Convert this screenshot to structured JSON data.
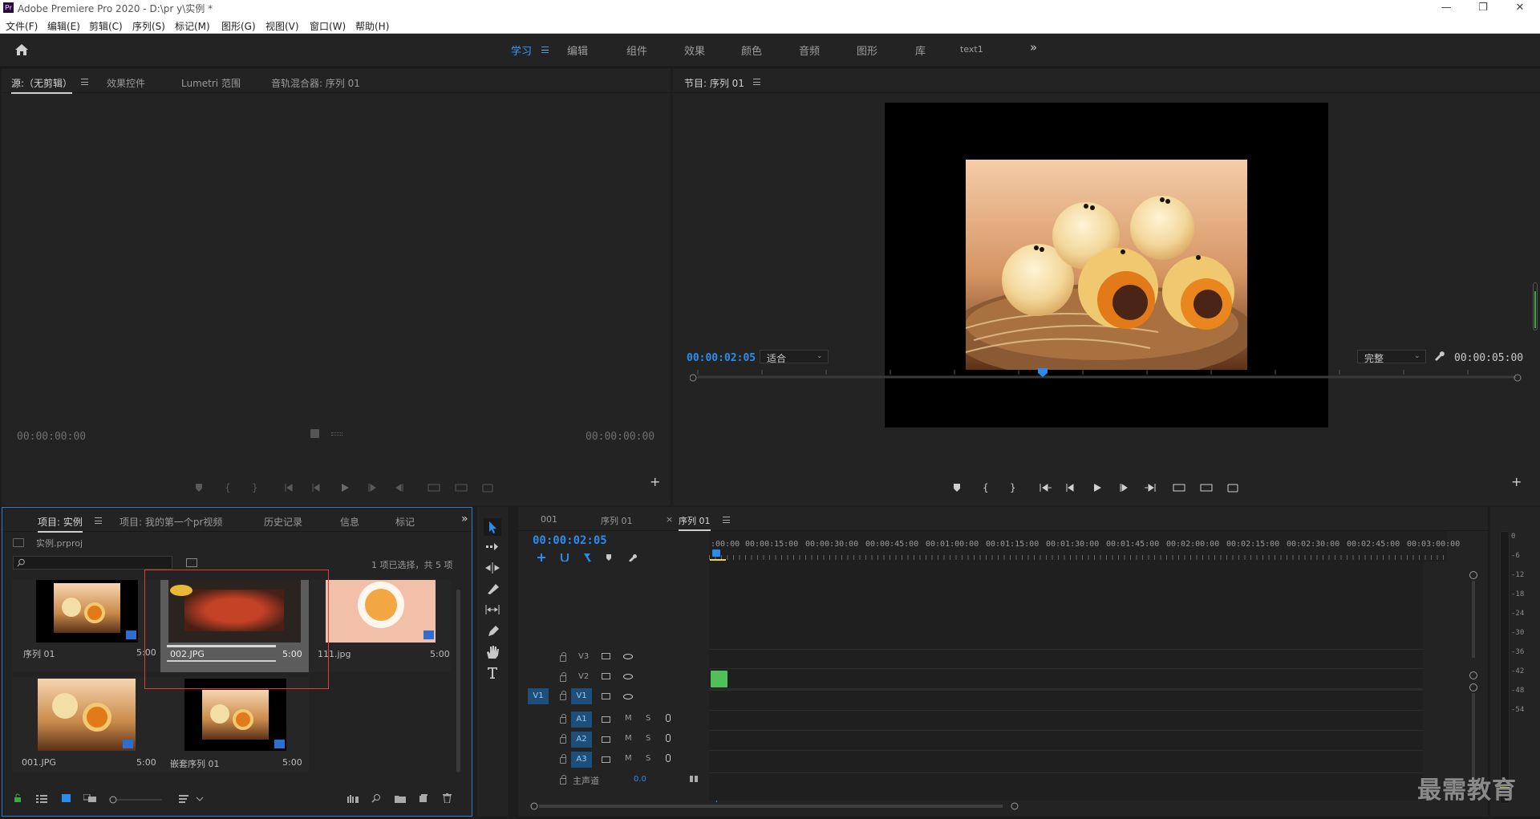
{
  "window": {
    "logo_text": "Pr",
    "title": "Adobe Premiere Pro 2020 - D:\\pr y\\实例 *",
    "minimize": "—",
    "maximize": "❐",
    "close": "✕"
  },
  "menu": [
    "文件(F)",
    "编辑(E)",
    "剪辑(C)",
    "序列(S)",
    "标记(M)",
    "图形(G)",
    "视图(V)",
    "窗口(W)",
    "帮助(H)"
  ],
  "workspaces": {
    "items": [
      "学习",
      "编辑",
      "组件",
      "效果",
      "颜色",
      "音频",
      "图形",
      "库",
      "text1"
    ],
    "active": "学习",
    "more": "»"
  },
  "source_panel": {
    "tabs": [
      "源:（无剪辑）",
      "效果控件",
      "Lumetri 范围",
      "音轨混合器: 序列 01"
    ],
    "timecode_left": "00:00:00:00",
    "timecode_right": "00:00:00:00",
    "add": "+"
  },
  "program_panel": {
    "title": "节目: 序列 01",
    "timecode": "00:00:02:05",
    "zoom": "适合",
    "quality": "完整",
    "duration": "00:00:05:00",
    "add": "+"
  },
  "project_panel": {
    "tabs": [
      "项目: 实例",
      "项目: 我的第一个pr视频",
      "历史记录",
      "信息",
      "标记"
    ],
    "more": "»",
    "file": "实例.prproj",
    "search_placeholder": "",
    "selection_info": "1 项已选择，共 5 项",
    "items": [
      {
        "name": "序列 01",
        "duration": "5:00"
      },
      {
        "name": "002.JPG",
        "duration": "5:00"
      },
      {
        "name": "111.jpg",
        "duration": "5:00"
      },
      {
        "name": "001.JPG",
        "duration": "5:00"
      },
      {
        "name": "嵌套序列 01",
        "duration": "5:00"
      }
    ]
  },
  "timeline": {
    "tabs": [
      {
        "label": "001",
        "closable": false
      },
      {
        "label": "序列 01",
        "closable": false
      },
      {
        "label": "序列 01",
        "closable": true,
        "active": true
      }
    ],
    "close_glyph": "×",
    "timecode": "00:00:02:05",
    "ruler": [
      ":00:00",
      "00:00:15:00",
      "00:00:30:00",
      "00:00:45:00",
      "00:01:00:00",
      "00:01:15:00",
      "00:01:30:00",
      "00:01:45:00",
      "00:02:00:00",
      "00:02:15:00",
      "00:02:30:00",
      "00:02:45:00",
      "00:03:00:00"
    ],
    "video_tracks": [
      "V3",
      "V2",
      "V1"
    ],
    "source_patch": "V1",
    "audio_tracks": [
      "A1",
      "A2",
      "A3"
    ],
    "m_label": "M",
    "s_label": "S",
    "master_label": "主声道",
    "master_value": "0.0"
  },
  "vu_meter": {
    "labels": [
      "0",
      "-6",
      "-12",
      "-18",
      "-24",
      "-30",
      "-36",
      "-42",
      "-48",
      "-54"
    ]
  },
  "watermark": "最需教育",
  "colors": {
    "accent": "#2d8ceb",
    "clip_green": "#4fc05a",
    "selection_red": "#e23b3b",
    "panel_focus": "#2e7bd1"
  }
}
